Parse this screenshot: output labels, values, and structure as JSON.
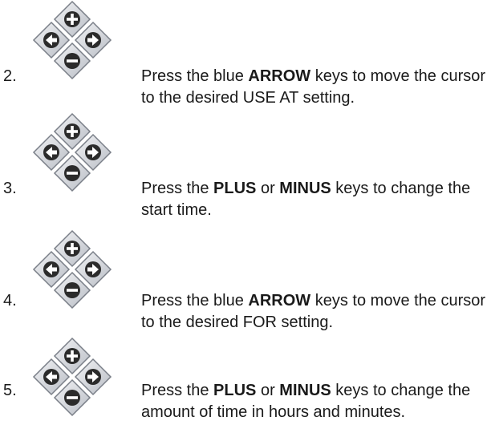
{
  "steps": [
    {
      "number": "2.",
      "icon": "arrow-keypad-icon",
      "parts": [
        "Press the blue ",
        "ARROW",
        "  keys to move the cursor to the desired USE AT setting."
      ]
    },
    {
      "number": "3.",
      "icon": "arrow-keypad-icon",
      "parts": [
        "Press the ",
        "PLUS",
        " or ",
        "MINUS",
        " keys to change the start time."
      ]
    },
    {
      "number": "4.",
      "icon": "arrow-keypad-icon",
      "parts": [
        "Press the blue ",
        "ARROW",
        "  keys to move the cursor to the desired FOR setting."
      ]
    },
    {
      "number": "5.",
      "icon": "arrow-keypad-icon",
      "parts": [
        "Press the ",
        "PLUS",
        " or ",
        "MINUS",
        " keys to change the amount of time in hours and minutes."
      ]
    }
  ],
  "colors": {
    "key_fill": "#d4d7dd",
    "key_stroke": "#7a7f88",
    "symbol": "#2b2b2b"
  }
}
